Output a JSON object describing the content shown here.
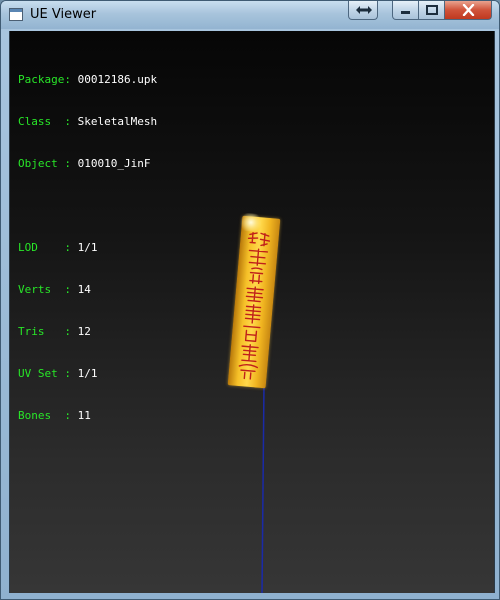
{
  "window": {
    "title": "UE Viewer"
  },
  "info": {
    "rows": [
      {
        "key": "Package: ",
        "value": "00012186.upk"
      },
      {
        "key": "Class  : ",
        "value": "SkeletalMesh"
      },
      {
        "key": "Object : ",
        "value": "010010_JinF"
      }
    ],
    "stats": [
      {
        "key": "LOD    : ",
        "value": "1/1"
      },
      {
        "key": "Verts  : ",
        "value": "14"
      },
      {
        "key": "Tris   : ",
        "value": "12"
      },
      {
        "key": "UV Set : ",
        "value": "1/1"
      },
      {
        "key": "Bones  : ",
        "value": "11"
      }
    ]
  },
  "colors": {
    "label": "#28e628",
    "value": "#ffffff",
    "bone": "#1a2aa8",
    "talisman": "#f4bb24",
    "glyph": "#c0201a"
  },
  "icons": {
    "app": "app-window-icon",
    "restore": "double-arrow-icon",
    "minimize": "minimize-icon",
    "maximize": "maximize-icon",
    "close": "close-icon"
  }
}
